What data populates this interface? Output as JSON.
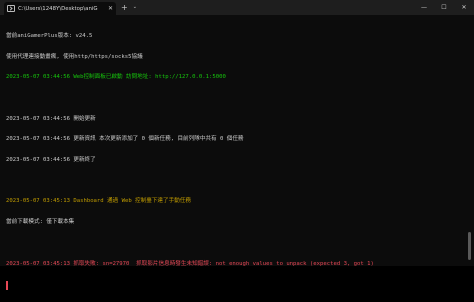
{
  "window": {
    "tab_title": "C:\\Users\\1248Y\\Desktop\\aniG",
    "close_glyph": "✕",
    "new_tab_glyph": "+",
    "dropdown_glyph": "⌄",
    "minimize_glyph": "—",
    "maximize_glyph": "☐",
    "window_close_glyph": "✕"
  },
  "terminal": {
    "lines": [
      {
        "text": "當前aniGamerPlus版本: v24.5",
        "color": "w"
      },
      {
        "text": "使用代理連接動畫瘋, 使用http/https/socks5協議",
        "color": "w"
      },
      {
        "text": "2023-05-07 03:44:56 Web控制面板已啟動 訪問地址: http://127.0.0.1:5000",
        "color": "g"
      },
      {
        "text": "",
        "color": "w"
      },
      {
        "text": "2023-05-07 03:44:56 開始更新",
        "color": "w"
      },
      {
        "text": "2023-05-07 03:44:56 更新資訊 本次更新添加了 0 個新任務, 目前列隊中共有 0 個任務",
        "color": "w"
      },
      {
        "text": "2023-05-07 03:44:56 更新終了",
        "color": "w"
      },
      {
        "text": "",
        "color": "w"
      },
      {
        "text": "2023-05-07 03:45:13 Dashboard 通過 Web 控制臺下達了手動任務",
        "color": "y"
      },
      {
        "text": "當前下載模式: 僅下載本集",
        "color": "w"
      },
      {
        "text": "",
        "color": "w"
      },
      {
        "text": "2023-05-07 03:45:13 抓取失敗: sn=27970  抓取影片信息時發生未知錯誤: not enough values to unpack (expected 3, got 1)",
        "color": "r"
      }
    ]
  },
  "colors": {
    "background": "#0c0c0c",
    "titlebar": "#1e1e1e",
    "text": "#cccccc",
    "green": "#16c60c",
    "yellow": "#c19c00",
    "red": "#e74856"
  }
}
